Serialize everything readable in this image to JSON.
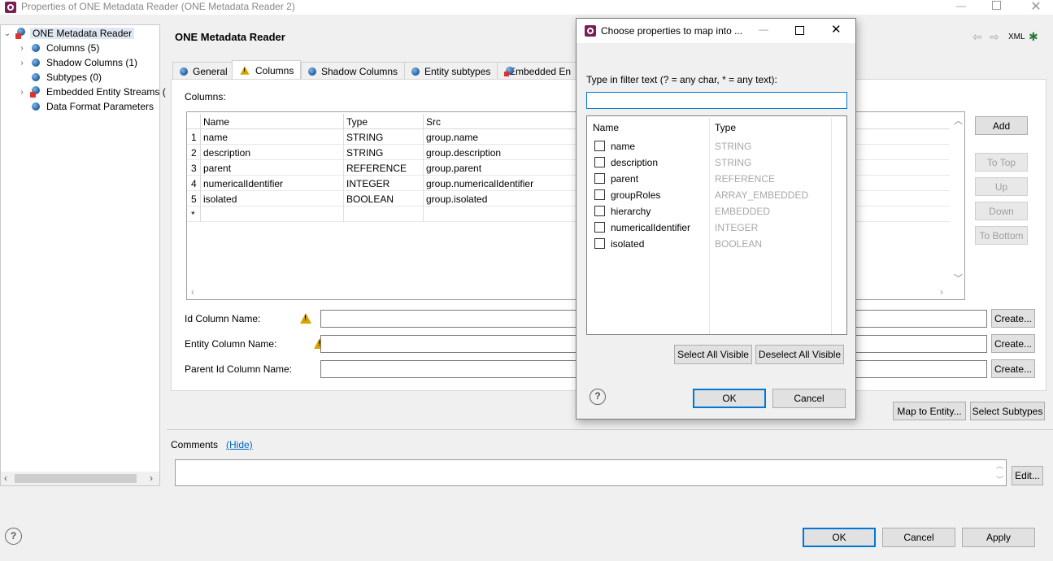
{
  "window": {
    "title": "Properties of ONE Metadata Reader (ONE Metadata Reader 2)"
  },
  "tree": {
    "root": "ONE Metadata Reader",
    "items": [
      {
        "label": "Columns (5)",
        "expandable": true
      },
      {
        "label": "Shadow Columns (1)",
        "expandable": true
      },
      {
        "label": "Subtypes (0)",
        "expandable": false
      },
      {
        "label": "Embedded Entity Streams (",
        "expandable": true
      },
      {
        "label": "Data Format Parameters",
        "expandable": false
      }
    ]
  },
  "panel": {
    "title": "ONE Metadata Reader",
    "xml_label": "XML",
    "tabs": [
      "General",
      "Columns",
      "Shadow Columns",
      "Entity subtypes",
      "Embedded En"
    ],
    "columns_label": "Columns:",
    "table": {
      "headers": [
        "Name",
        "Type",
        "Src"
      ],
      "rows": [
        {
          "num": "1",
          "name": "name",
          "type": "STRING",
          "src": "group.name"
        },
        {
          "num": "2",
          "name": "description",
          "type": "STRING",
          "src": "group.description"
        },
        {
          "num": "3",
          "name": "parent",
          "type": "REFERENCE",
          "src": "group.parent"
        },
        {
          "num": "4",
          "name": "numericalIdentifier",
          "type": "INTEGER",
          "src": "group.numericalIdentifier"
        },
        {
          "num": "5",
          "name": "isolated",
          "type": "BOOLEAN",
          "src": "group.isolated"
        }
      ],
      "new_row_marker": "*"
    },
    "side_buttons": {
      "add": "Add",
      "to_top": "To Top",
      "up": "Up",
      "down": "Down",
      "to_bottom": "To Bottom"
    },
    "fields": [
      {
        "label": "Id Column Name:",
        "button": "Create..."
      },
      {
        "label": "Entity Column Name:",
        "button": "Create..."
      },
      {
        "label": "Parent Id Column Name:",
        "button": "Create..."
      }
    ],
    "map_to_entity": "Map to Entity...",
    "select_subtypes": "Select Subtypes",
    "comments_label": "Comments",
    "hide_link": "(Hide)",
    "edit_button": "Edit..."
  },
  "footer": {
    "ok": "OK",
    "cancel": "Cancel",
    "apply": "Apply"
  },
  "dialog": {
    "title": "Choose properties to map into ...",
    "filter_label": "Type in filter text (? = any char, * = any text):",
    "filter_value": "",
    "headers": [
      "Name",
      "Type"
    ],
    "items": [
      {
        "name": "name",
        "type": "STRING"
      },
      {
        "name": "description",
        "type": "STRING"
      },
      {
        "name": "parent",
        "type": "REFERENCE"
      },
      {
        "name": "groupRoles",
        "type": "ARRAY_EMBEDDED"
      },
      {
        "name": "hierarchy",
        "type": "EMBEDDED"
      },
      {
        "name": "numericalIdentifier",
        "type": "INTEGER"
      },
      {
        "name": "isolated",
        "type": "BOOLEAN"
      }
    ],
    "select_all": "Select All Visible",
    "deselect_all": "Deselect All Visible",
    "ok": "OK",
    "cancel": "Cancel"
  },
  "colors": {
    "accent": "#0078d7",
    "brand": "#7a1f55",
    "link": "#0066cc"
  }
}
